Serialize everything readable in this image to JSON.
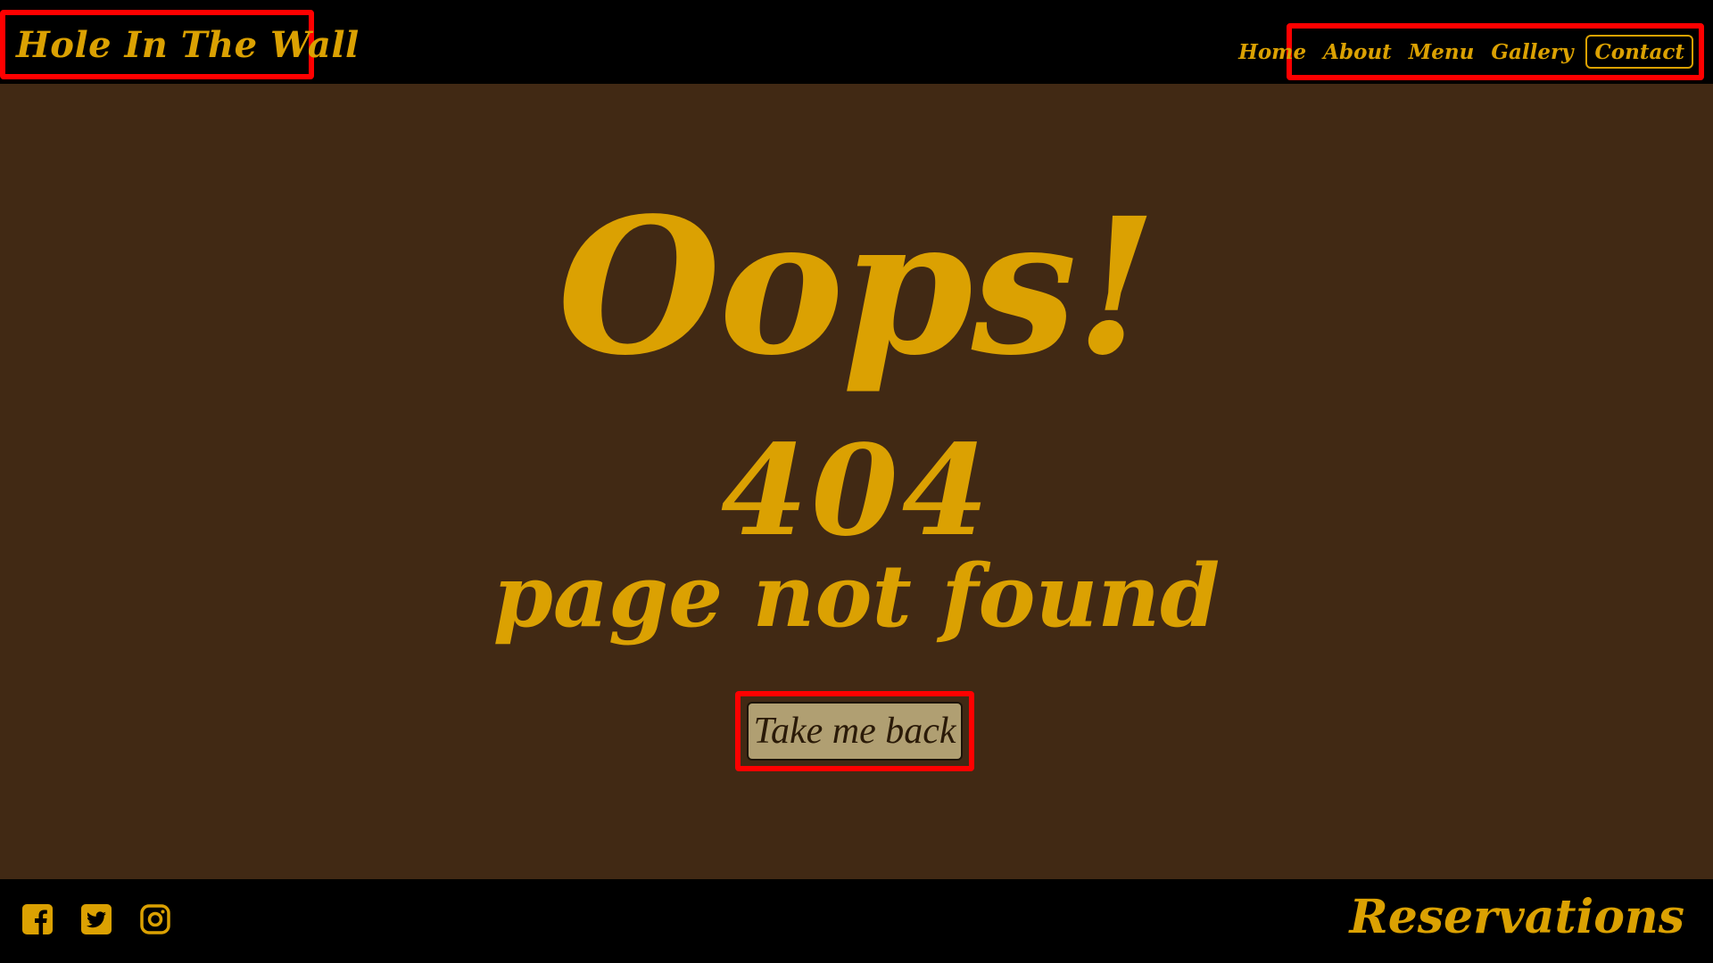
{
  "header": {
    "brand": "Hole In The Wall",
    "nav": [
      {
        "label": "Home"
      },
      {
        "label": "About"
      },
      {
        "label": "Menu"
      },
      {
        "label": "Gallery"
      },
      {
        "label": "Contact"
      }
    ]
  },
  "main": {
    "headline": "Oops!",
    "code": "404",
    "message": "page not found",
    "back_button": "Take me back"
  },
  "footer": {
    "social_icons": [
      "facebook-icon",
      "twitter-icon",
      "instagram-icon"
    ],
    "reservations": "Reservations"
  },
  "colors": {
    "accent": "#dba102",
    "main_background": "#412914",
    "header_footer_background": "#000000",
    "button_background": "#b09f72",
    "highlight_border": "#ff0000"
  }
}
